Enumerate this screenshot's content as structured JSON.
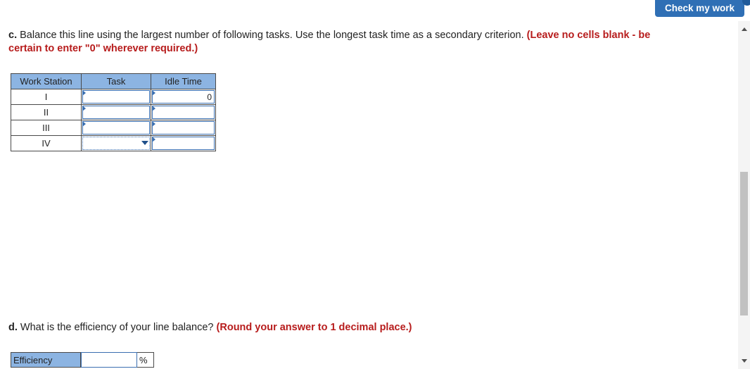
{
  "header": {
    "check_button_label": "Check my work"
  },
  "part_c": {
    "label": "c.",
    "text": " Balance this line using the largest number of following tasks. Use the longest task time as a secondary criterion. ",
    "instruction": "(Leave no cells blank - be certain to enter \"0\" wherever required.)"
  },
  "table": {
    "headers": [
      "Work Station",
      "Task",
      "Idle Time"
    ],
    "rows": [
      {
        "station": "I",
        "task": "",
        "idle_time": "0"
      },
      {
        "station": "II",
        "task": "",
        "idle_time": ""
      },
      {
        "station": "III",
        "task": "",
        "idle_time": ""
      },
      {
        "station": "IV",
        "task": "",
        "idle_time": ""
      }
    ]
  },
  "part_d": {
    "label": "d.",
    "text": " What is the efficiency of your line balance? ",
    "instruction": "(Round your answer to 1 decimal place.)"
  },
  "efficiency": {
    "label": "Efficiency",
    "value": "",
    "unit": "%"
  },
  "colors": {
    "accent": "#2f6fb5",
    "header_fill": "#8cb4e2",
    "instruction_red": "#b71c1c"
  }
}
